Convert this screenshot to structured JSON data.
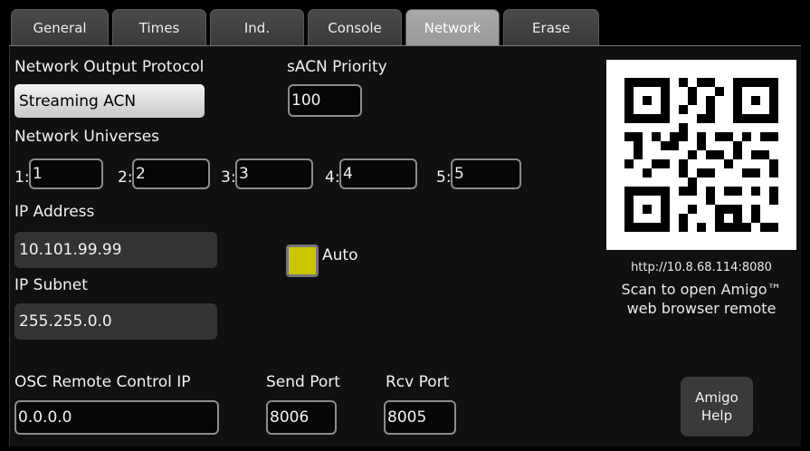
{
  "tabs": [
    {
      "label": "General",
      "active": false
    },
    {
      "label": "Times",
      "active": false
    },
    {
      "label": "Ind.",
      "active": false
    },
    {
      "label": "Console",
      "active": false
    },
    {
      "label": "Network",
      "active": true
    },
    {
      "label": "Erase",
      "active": false
    }
  ],
  "protocol": {
    "label": "Network Output Protocol",
    "value": "Streaming ACN"
  },
  "priority": {
    "label": "sACN Priority",
    "value": "100"
  },
  "universes": {
    "label": "Network Universes",
    "items": [
      {
        "index": "1:",
        "value": "1"
      },
      {
        "index": "2:",
        "value": "2"
      },
      {
        "index": "3:",
        "value": "3"
      },
      {
        "index": "4:",
        "value": "4"
      },
      {
        "index": "5:",
        "value": "5"
      }
    ]
  },
  "ip_address": {
    "label": "IP Address",
    "value": "10.101.99.99"
  },
  "auto": {
    "label": "Auto",
    "checked": true,
    "color": "#c9c600"
  },
  "ip_subnet": {
    "label": "IP Subnet",
    "value": "255.255.0.0"
  },
  "osc": {
    "label": "OSC Remote Control IP",
    "value": "0.0.0.0"
  },
  "send_port": {
    "label": "Send Port",
    "value": "8006"
  },
  "rcv_port": {
    "label": "Rcv Port",
    "value": "8005"
  },
  "qr": {
    "url": "http://10.8.68.114:8080",
    "caption_line1": "Scan to open Amigo™",
    "caption_line2": "web browser remote"
  },
  "help_button": {
    "line1": "Amigo",
    "line2": "Help"
  }
}
